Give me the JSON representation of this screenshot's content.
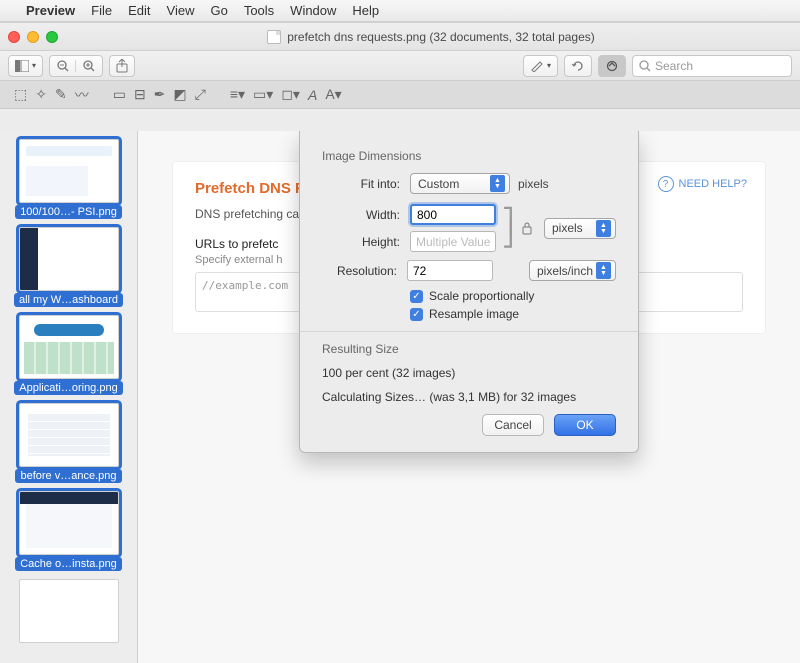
{
  "menubar": {
    "apple": "",
    "app": "Preview",
    "items": [
      "File",
      "Edit",
      "View",
      "Go",
      "Tools",
      "Window",
      "Help"
    ]
  },
  "titlebar": {
    "title": "prefetch dns requests.png (32 documents, 32 total pages)"
  },
  "toolbar": {
    "search_placeholder": "Search"
  },
  "sidebar": {
    "thumbs": [
      {
        "label": "100/100…- PSI.png",
        "selected": true,
        "cls": "t1"
      },
      {
        "label": "all my W…ashboard",
        "selected": true,
        "cls": "t2"
      },
      {
        "label": "Applicati…oring.png",
        "selected": true,
        "cls": "t3"
      },
      {
        "label": "before v…ance.png",
        "selected": true,
        "cls": "t4"
      },
      {
        "label": "Cache o…insta.png",
        "selected": true,
        "cls": "t5"
      },
      {
        "label": "",
        "selected": false,
        "cls": ""
      }
    ]
  },
  "document": {
    "heading": "Prefetch DNS Re",
    "subline": "DNS prefetching ca",
    "urls_label": "URLs to prefetc",
    "urls_hint": "Specify external h",
    "textarea_value": "//example.com",
    "needhelp": "NEED HELP?"
  },
  "sheet": {
    "section1": "Image Dimensions",
    "fitinto_label": "Fit into:",
    "fitinto_value": "Custom",
    "fitinto_unit": "pixels",
    "width_label": "Width:",
    "width_value": "800",
    "height_label": "Height:",
    "height_value": "Multiple Values",
    "wh_unit": "pixels",
    "resolution_label": "Resolution:",
    "resolution_value": "72",
    "resolution_unit": "pixels/inch",
    "chk_scale": "Scale proportionally",
    "chk_resample": "Resample image",
    "section2": "Resulting Size",
    "result_percent": "100 per cent (32 images)",
    "result_calc": "Calculating Sizes… (was 3,1 MB) for 32 images",
    "cancel": "Cancel",
    "ok": "OK"
  }
}
